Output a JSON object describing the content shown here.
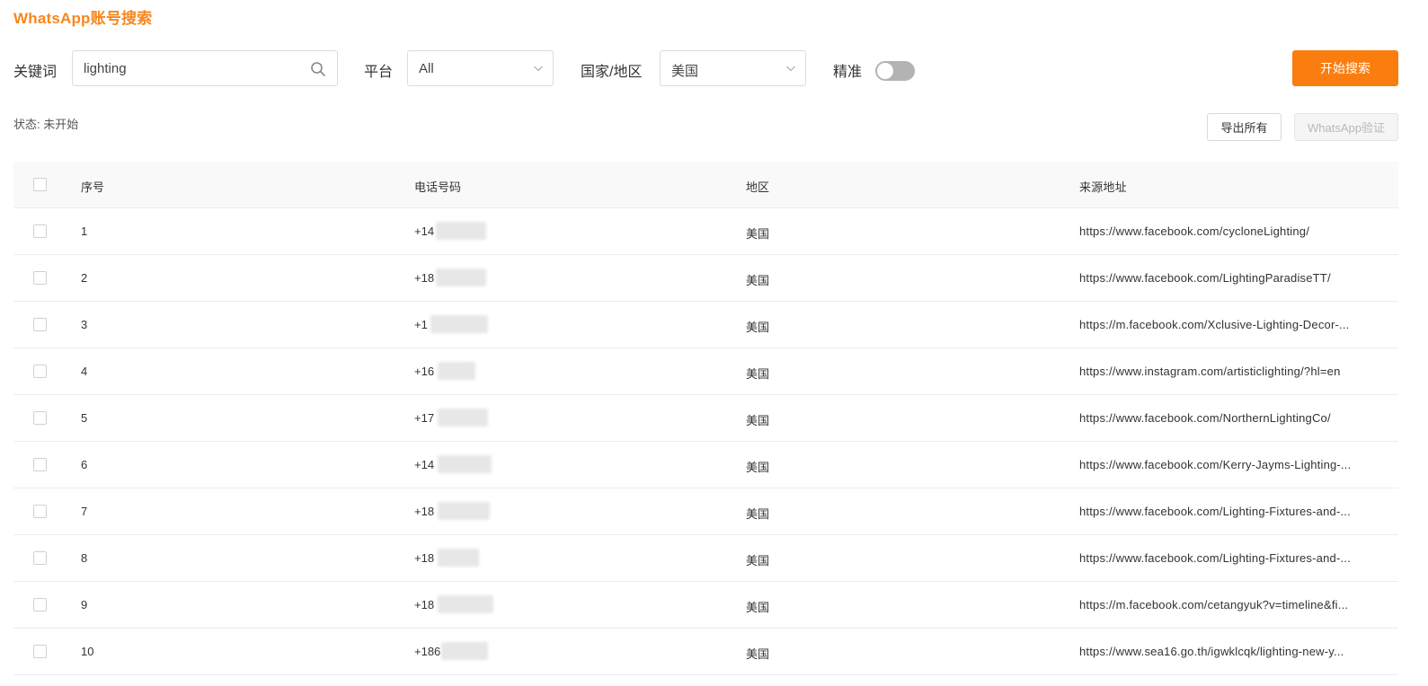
{
  "title": "WhatsApp账号搜索",
  "filters": {
    "keyword_label": "关键词",
    "keyword_value": "lighting",
    "platform_label": "平台",
    "platform_value": "All",
    "country_label": "国家/地区",
    "country_value": "美国",
    "exact_label": "精准",
    "exact_on": false,
    "start_button": "开始搜索"
  },
  "status": {
    "text": "状态: 未开始"
  },
  "actions": {
    "export_all": "导出所有",
    "whatsapp_verify": "WhatsApp验证"
  },
  "table": {
    "headers": [
      "序号",
      "电话号码",
      "地区",
      "来源地址"
    ],
    "rows": [
      {
        "idx": "1",
        "phone": "+14          68",
        "region": "美国",
        "source": "https://www.facebook.com/cycloneLighting/"
      },
      {
        "idx": "2",
        "phone": "+18          65",
        "region": "美国",
        "source": "https://www.facebook.com/LightingParadiseTT/"
      },
      {
        "idx": "3",
        "phone": "+1           36",
        "region": "美国",
        "source": "https://m.facebook.com/Xclusive-Lighting-Decor-..."
      },
      {
        "idx": "4",
        "phone": "+16        05",
        "region": "美国",
        "source": "https://www.instagram.com/artisticlighting/?hl=en"
      },
      {
        "idx": "5",
        "phone": "+17          39",
        "region": "美国",
        "source": "https://www.facebook.com/NorthernLightingCo/"
      },
      {
        "idx": "6",
        "phone": "+14          59",
        "region": "美国",
        "source": "https://www.facebook.com/Kerry-Jayms-Lighting-..."
      },
      {
        "idx": "7",
        "phone": "+18          45",
        "region": "美国",
        "source": "https://www.facebook.com/Lighting-Fixtures-and-..."
      },
      {
        "idx": "8",
        "phone": "+18",
        "region": "美国",
        "source": "https://www.facebook.com/Lighting-Fixtures-and-..."
      },
      {
        "idx": "9",
        "phone": "+18         000",
        "region": "美国",
        "source": "https://m.facebook.com/cetangyuk?v=timeline&fi..."
      },
      {
        "idx": "10",
        "phone": "+186        875",
        "region": "美国",
        "source": "https://www.sea16.go.th/igwklcqk/lighting-new-y..."
      }
    ]
  },
  "colors": {
    "accent": "#fa7d0f",
    "title": "#f7861e",
    "toggle_off": "#b3b3b3"
  },
  "icons": {
    "search": "search-icon",
    "dropdown": "chevron-down-icon"
  }
}
